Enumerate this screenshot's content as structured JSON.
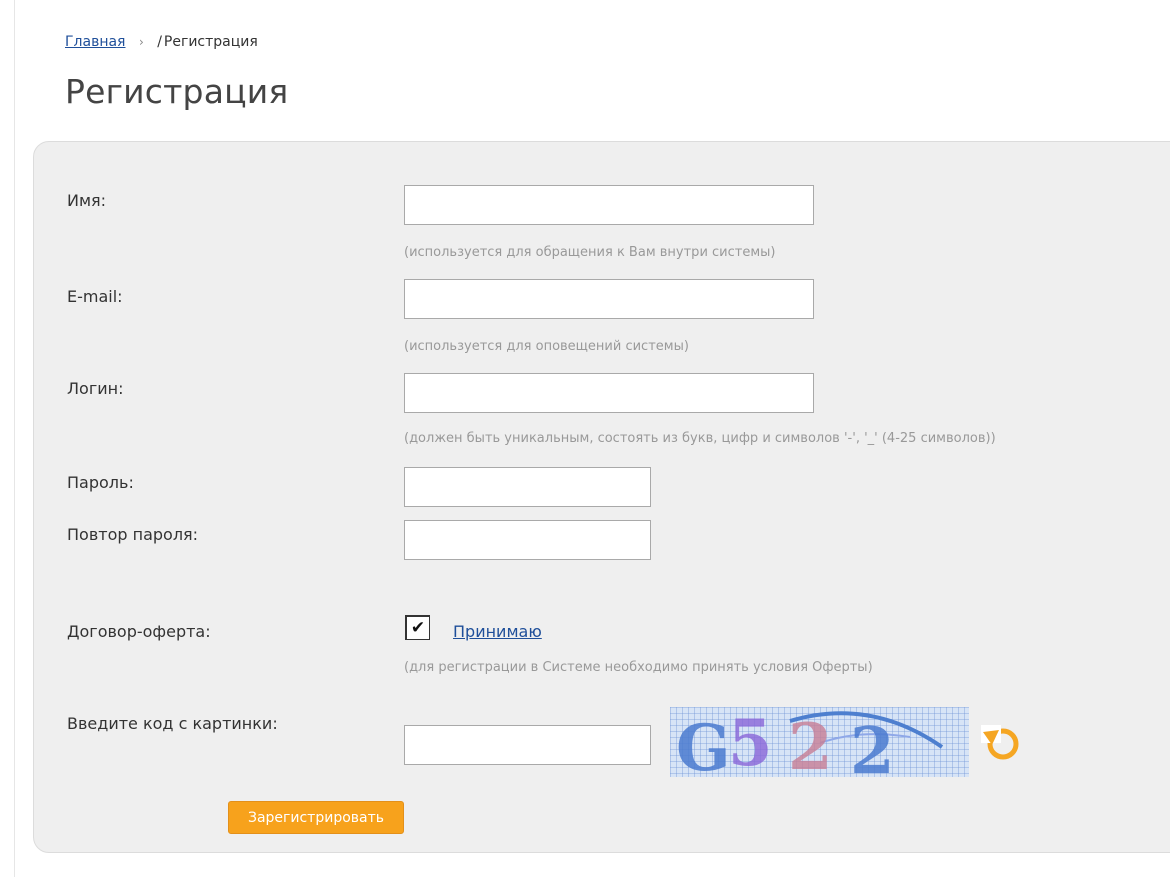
{
  "breadcrumb": {
    "home": "Главная",
    "separator": "›",
    "current": "Регистрация",
    "current_prefix": "/"
  },
  "page": {
    "title": "Регистрация"
  },
  "form": {
    "name": {
      "label": "Имя:",
      "value": "",
      "hint": "(используется для обращения к Вам внутри системы)"
    },
    "email": {
      "label": "E-mail:",
      "value": "",
      "hint": "(используется для оповещений системы)"
    },
    "login": {
      "label": "Логин:",
      "value": "",
      "hint": "(должен быть уникальным, состоять из букв, цифр и символов '-', '_' (4-25 символов))"
    },
    "password": {
      "label": "Пароль:",
      "value": ""
    },
    "password_repeat": {
      "label": "Повтор пароля:",
      "value": ""
    },
    "offer": {
      "label": "Договор-оферта:",
      "checked": true,
      "check_glyph": "✔",
      "link": "Принимаю",
      "hint": "(для регистрации в Системе необходимо принять условия Оферты)"
    },
    "captcha": {
      "label": "Введите код с картинки:",
      "value": "",
      "image_text": "G522",
      "refresh_icon": "refresh-icon"
    },
    "submit_label": "Зарегистрировать"
  },
  "colors": {
    "link": "#1f4f9a",
    "button": "#f7a21c",
    "panel": "#efefef",
    "hint": "#999999",
    "refresh": "#f5a623"
  }
}
